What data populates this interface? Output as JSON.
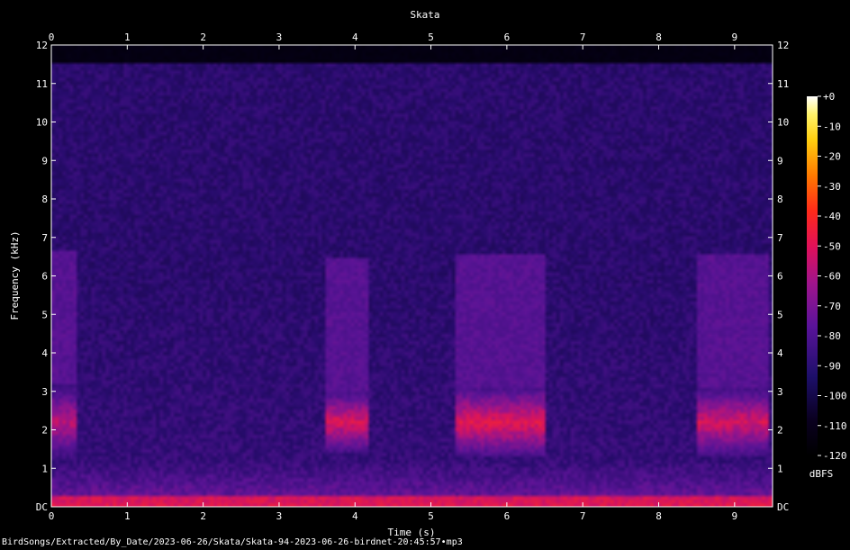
{
  "chart_data": {
    "type": "heatmap",
    "title": "Skata",
    "xlabel": "Time (s)",
    "ylabel": "Frequency (kHz)",
    "xlim": [
      0,
      9.5
    ],
    "ylim": [
      0,
      12
    ],
    "x_ticks": [
      "0",
      "1",
      "2",
      "3",
      "4",
      "5",
      "6",
      "7",
      "8",
      "9"
    ],
    "y_ticks": [
      "DC",
      "1",
      "2",
      "3",
      "4",
      "5",
      "6",
      "7",
      "8",
      "9",
      "10",
      "11",
      "12"
    ],
    "colorbar": {
      "label": "dBFS",
      "range": [
        -120,
        0
      ],
      "ticks": [
        "+0",
        "-10",
        "-20",
        "-30",
        "-40",
        "-50",
        "-60",
        "-70",
        "-80",
        "-90",
        "-100",
        "-110",
        "-120"
      ]
    },
    "content_max_khz": 11.5,
    "calls": [
      {
        "start_s": 0.0,
        "end_s": 0.35,
        "low_khz": 1.2,
        "high_khz": 3.2,
        "level": 0.62
      },
      {
        "start_s": 3.6,
        "end_s": 4.2,
        "low_khz": 1.4,
        "high_khz": 3.0,
        "level": 0.7
      },
      {
        "start_s": 5.3,
        "end_s": 6.5,
        "low_khz": 1.3,
        "high_khz": 3.1,
        "level": 0.72
      },
      {
        "start_s": 8.5,
        "end_s": 9.45,
        "low_khz": 1.3,
        "high_khz": 3.1,
        "level": 0.68
      }
    ]
  },
  "footer": "BirdSongs/Extracted/By_Date/2023-06-26/Skata/Skata-94-2023-06-26-birdnet-20:45:57•mp3"
}
